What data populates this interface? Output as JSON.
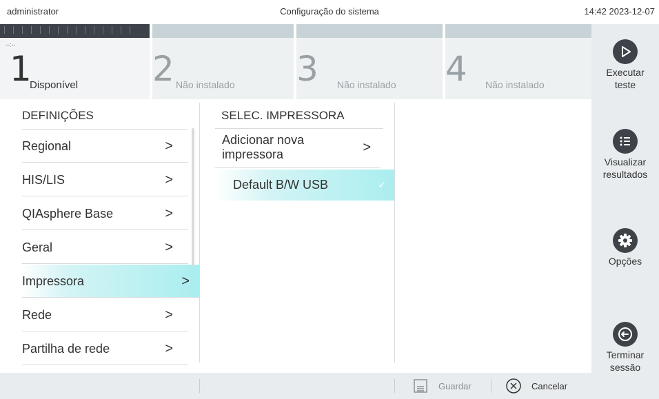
{
  "topbar": {
    "user": "administrator",
    "title": "Configuração do sistema",
    "datetime": "14:42 2023-12-07"
  },
  "modules": [
    {
      "number": "1",
      "status": "Disponível",
      "dashes": "--:--"
    },
    {
      "number": "2",
      "status": "Não instalado"
    },
    {
      "number": "3",
      "status": "Não instalado"
    },
    {
      "number": "4",
      "status": "Não instalado"
    }
  ],
  "sidebar": {
    "run_test": "Executar teste",
    "view_results": "Visualizar resultados",
    "options": "Opções",
    "logout": "Terminar sessão"
  },
  "settings": {
    "header": "DEFINIÇÕES",
    "items": [
      {
        "label": "Regional"
      },
      {
        "label": "HIS/LIS"
      },
      {
        "label": "QIAsphere Base"
      },
      {
        "label": "Geral"
      },
      {
        "label": "Impressora"
      },
      {
        "label": "Rede"
      },
      {
        "label": "Partilha de rede"
      }
    ],
    "selected": "Impressora"
  },
  "printer_panel": {
    "header": "SELEC. IMPRESSORA",
    "add_printer": "Adicionar nova impressora",
    "printers": [
      {
        "label": "Default B/W USB",
        "selected": true
      }
    ]
  },
  "bottombar": {
    "save": "Guardar",
    "cancel": "Cancelar"
  },
  "colors": {
    "selected_gradient_end": "#aaeef0",
    "dark": "#3d4349",
    "sidebar_bg": "#e8ecee"
  }
}
